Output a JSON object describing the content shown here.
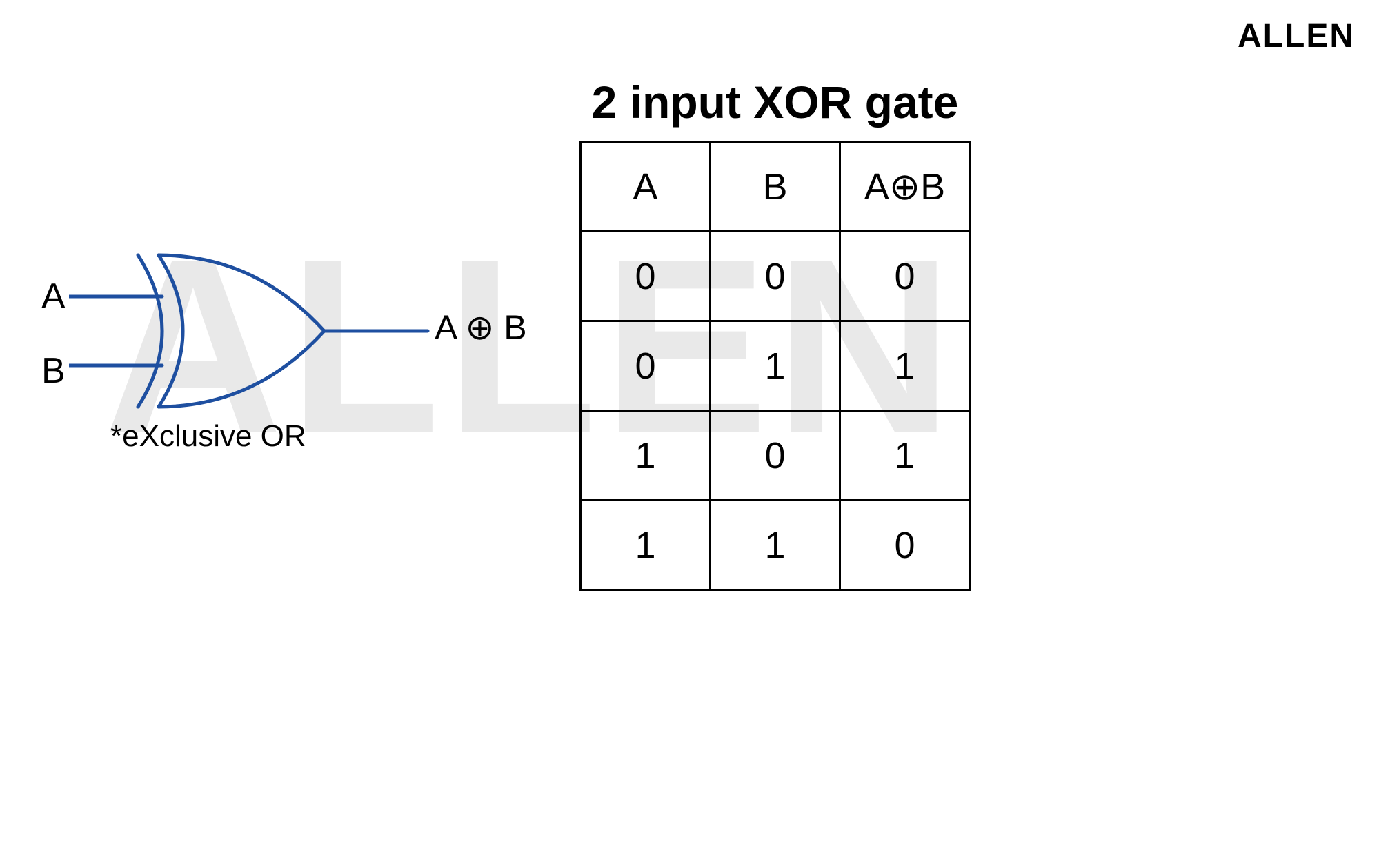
{
  "brand": "ALLEN",
  "watermark": "ALLEN",
  "diagram": {
    "input_a": "A",
    "input_b": "B",
    "output": "A ⊕ B",
    "caption": "*eXclusive OR",
    "gate_color": "#1e3a8a"
  },
  "table": {
    "title": "2 input XOR gate",
    "headers": [
      "A",
      "B",
      "A⊕B"
    ],
    "rows": [
      [
        "0",
        "0",
        "0"
      ],
      [
        "0",
        "1",
        "1"
      ],
      [
        "1",
        "0",
        "1"
      ],
      [
        "1",
        "1",
        "0"
      ]
    ]
  }
}
